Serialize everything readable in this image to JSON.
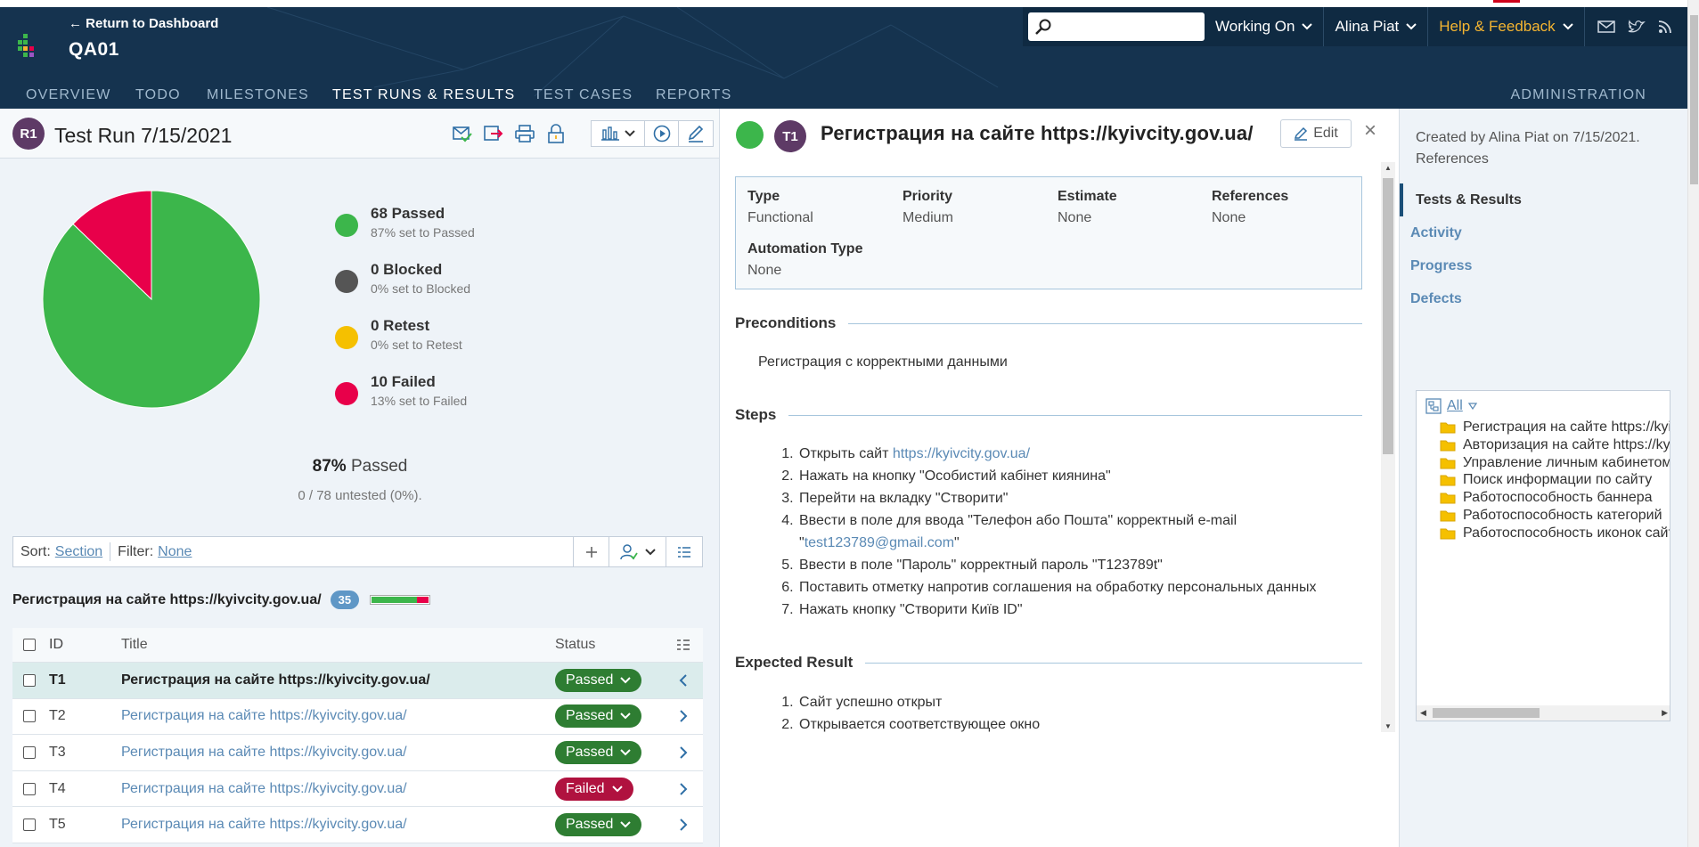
{
  "header": {
    "return_link": "← Return to Dashboard",
    "project": "QA01",
    "search_placeholder": "",
    "working_on": "Working On",
    "user": "Alina Piat",
    "help": "Help & Feedback",
    "colors": {
      "bar": "#15334f",
      "help": "#f5b531"
    }
  },
  "tabs": [
    {
      "label": "OVERVIEW"
    },
    {
      "label": "TODO"
    },
    {
      "label": "MILESTONES"
    },
    {
      "label": "TEST RUNS & RESULTS"
    },
    {
      "label": "TEST CASES"
    },
    {
      "label": "REPORTS"
    }
  ],
  "administration": "ADMINISTRATION",
  "run": {
    "badge": "R1",
    "title": "Test Run 7/15/2021"
  },
  "stats": {
    "passed_count": 68,
    "failed_count": 10,
    "legend": [
      {
        "label": "68 Passed",
        "sub": "87% set to Passed",
        "color": "#3cb64b"
      },
      {
        "label": "0 Blocked",
        "sub": "0% set to Blocked",
        "color": "#555555"
      },
      {
        "label": "0 Retest",
        "sub": "0% set to Retest",
        "color": "#f5c000"
      },
      {
        "label": "10 Failed",
        "sub": "13% set to Failed",
        "color": "#e8004a"
      }
    ],
    "percent_value": "87%",
    "percent_label": "Passed",
    "untested": "0 / 78 untested (0%)."
  },
  "sortbar": {
    "sort_label": "Sort:",
    "sort_value": "Section",
    "filter_label": "Filter:",
    "filter_value": "None"
  },
  "section": {
    "title": "Регистрация на сайте https://kyivcity.gov.ua/",
    "count": "35",
    "passed_fraction": 0.8
  },
  "table": {
    "headers": {
      "id": "ID",
      "title": "Title",
      "status": "Status"
    },
    "rows": [
      {
        "id": "T1",
        "title": "Регистрация на сайте https://kyivcity.gov.ua/",
        "status": "Passed"
      },
      {
        "id": "T2",
        "title": "Регистрация на сайте https://kyivcity.gov.ua/",
        "status": "Passed"
      },
      {
        "id": "T3",
        "title": "Регистрация на сайте https://kyivcity.gov.ua/",
        "status": "Passed"
      },
      {
        "id": "T4",
        "title": "Регистрация на сайте https://kyivcity.gov.ua/",
        "status": "Failed"
      },
      {
        "id": "T5",
        "title": "Регистрация на сайте https://kyivcity.gov.ua/",
        "status": "Passed"
      }
    ],
    "status_colors": {
      "Passed": "#2e7d32",
      "Failed": "#b0123f"
    }
  },
  "case": {
    "badge": "T1",
    "title": "Регистрация на сайте https://kyivcity.gov.ua/",
    "edit": "Edit",
    "close": "×",
    "fields": {
      "type_k": "Type",
      "type_v": "Functional",
      "priority_k": "Priority",
      "priority_v": "Medium",
      "estimate_k": "Estimate",
      "estimate_v": "None",
      "references_k": "References",
      "references_v": "None",
      "automation_k": "Automation Type",
      "automation_v": "None"
    },
    "preconditions_head": "Preconditions",
    "preconditions": "Регистрация с корректными данными",
    "steps_head": "Steps",
    "step1_text": "Открыть сайт ",
    "step1_link": "https://kyivcity.gov.ua/",
    "step2": "Нажать на кнопку \"Особистий кабінет киянина\"",
    "step3": "Перейти на вкладку \"Створити\"",
    "step4_line1": "Ввести в поле для ввода \"Телефон або Пошта\" корректный e-mail",
    "step4_q1": "\"",
    "step4_email": "test123789@gmail.com",
    "step4_q2": "\"",
    "step5": "Ввести в поле \"Пароль\" корректный пароль \"T123789t\"",
    "step6": "Поставить отметку напротив соглашения на обработку персональных данных",
    "step7": "Нажать кнопку \"Створити Київ ID\"",
    "expected_head": "Expected Result",
    "expected": [
      "Сайт успешно открыт",
      "Открывается соответствующее окно"
    ]
  },
  "right": {
    "created": "Created by Alina Piat on 7/15/2021.",
    "references": "References",
    "nav": [
      "Tests & Results",
      "Activity",
      "Progress",
      "Defects"
    ],
    "tree_filter": "All",
    "tree_items": [
      "Регистрация на сайте https://kyivcity.gov.ua/",
      "Авторизация на сайте https://kyivcity.gov.ua/",
      "Управление личным кабинетом",
      "Поиск информации по сайту",
      "Работоспособность баннера",
      "Работоспособность категорий",
      "Работоспособность иконок сайта"
    ]
  }
}
